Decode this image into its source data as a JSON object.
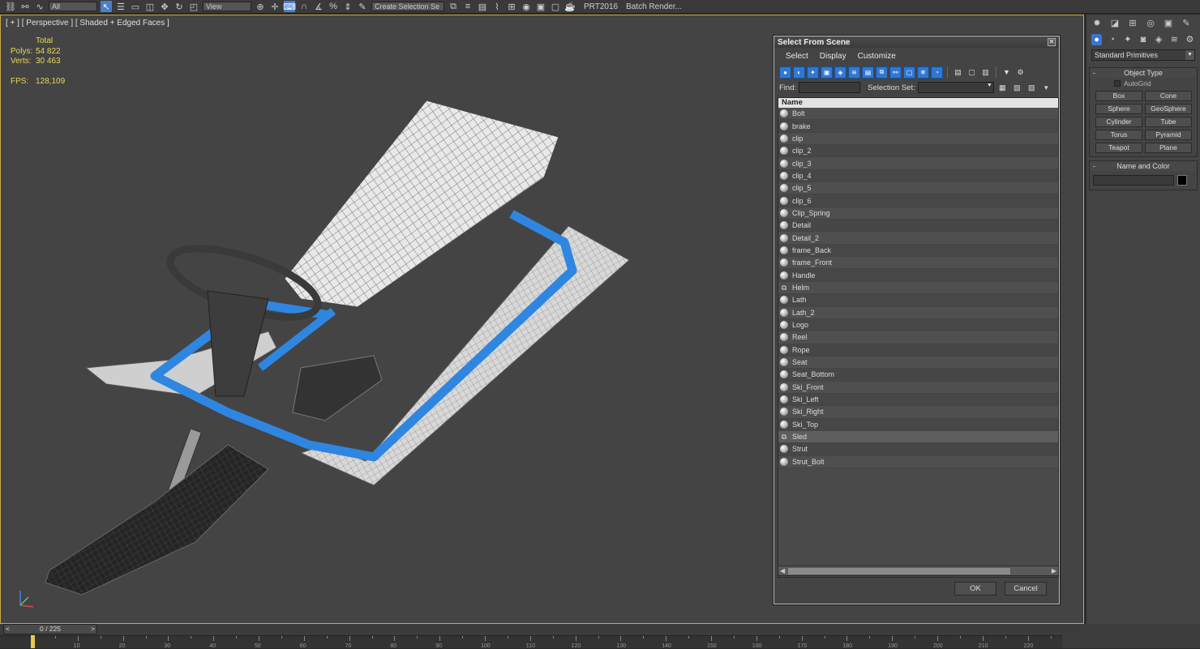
{
  "toolbar": {
    "filter_label": "All",
    "view_label": "View",
    "selection_set_placeholder": "Create Selection Se",
    "prt_label": "PRT2016",
    "batch_render_label": "Batch Render..."
  },
  "viewport": {
    "label": "[ + ] [ Perspective ] [ Shaded + Edged Faces ]",
    "stats": {
      "total_label": "Total",
      "polys_label": "Polys:",
      "polys_value": "54 822",
      "verts_label": "Verts:",
      "verts_value": "30 463",
      "fps_label": "FPS:",
      "fps_value": "128,109"
    }
  },
  "dialog": {
    "title": "Select From Scene",
    "close": "✕",
    "menu": [
      "Select",
      "Display",
      "Customize"
    ],
    "find_label": "Find:",
    "find_value": "",
    "selection_set_label": "Selection Set:",
    "list_header": "Name",
    "items": [
      {
        "name": "Bolt",
        "type": "object"
      },
      {
        "name": "brake",
        "type": "object"
      },
      {
        "name": "clip",
        "type": "object"
      },
      {
        "name": "clip_2",
        "type": "object"
      },
      {
        "name": "clip_3",
        "type": "object"
      },
      {
        "name": "clip_4",
        "type": "object"
      },
      {
        "name": "clip_5",
        "type": "object"
      },
      {
        "name": "clip_6",
        "type": "object"
      },
      {
        "name": "Clip_Spring",
        "type": "object"
      },
      {
        "name": "Detail",
        "type": "object"
      },
      {
        "name": "Detail_2",
        "type": "object"
      },
      {
        "name": "frame_Back",
        "type": "object"
      },
      {
        "name": "frame_Front",
        "type": "object"
      },
      {
        "name": "Handle",
        "type": "object"
      },
      {
        "name": "Helm",
        "type": "group"
      },
      {
        "name": "Lath",
        "type": "object"
      },
      {
        "name": "Lath_2",
        "type": "object"
      },
      {
        "name": "Logo",
        "type": "object"
      },
      {
        "name": "Reel",
        "type": "object"
      },
      {
        "name": "Rope",
        "type": "object"
      },
      {
        "name": "Seat",
        "type": "object"
      },
      {
        "name": "Seat_Bottom",
        "type": "object"
      },
      {
        "name": "Ski_Front",
        "type": "object"
      },
      {
        "name": "Ski_Left",
        "type": "object"
      },
      {
        "name": "Ski_Right",
        "type": "object"
      },
      {
        "name": "Ski_Top",
        "type": "object"
      },
      {
        "name": "Sled",
        "type": "group",
        "selected": true
      },
      {
        "name": "Strut",
        "type": "object"
      },
      {
        "name": "Strut_Bolt",
        "type": "object"
      }
    ],
    "ok_label": "OK",
    "cancel_label": "Cancel"
  },
  "command_panel": {
    "category": "Standard Primitives",
    "object_type_title": "Object Type",
    "autogrid_label": "AutoGrid",
    "primitives": [
      "Box",
      "Cone",
      "Sphere",
      "GeoSphere",
      "Cylinder",
      "Tube",
      "Torus",
      "Pyramid",
      "Teapot",
      "Plane"
    ],
    "name_color_title": "Name and Color",
    "object_color": "#000000"
  },
  "timeline": {
    "frame_label": "0 / 225",
    "ticks": [
      "10",
      "20",
      "30",
      "40",
      "50",
      "60",
      "70",
      "80",
      "90",
      "100",
      "110",
      "120",
      "130",
      "140",
      "150",
      "160",
      "170",
      "180",
      "190",
      "200",
      "210",
      "220"
    ]
  },
  "colors": {
    "accent_blue": "#2f78d6",
    "viewport_border": "#c8a84a",
    "stats_yellow": "#e8d85a"
  }
}
